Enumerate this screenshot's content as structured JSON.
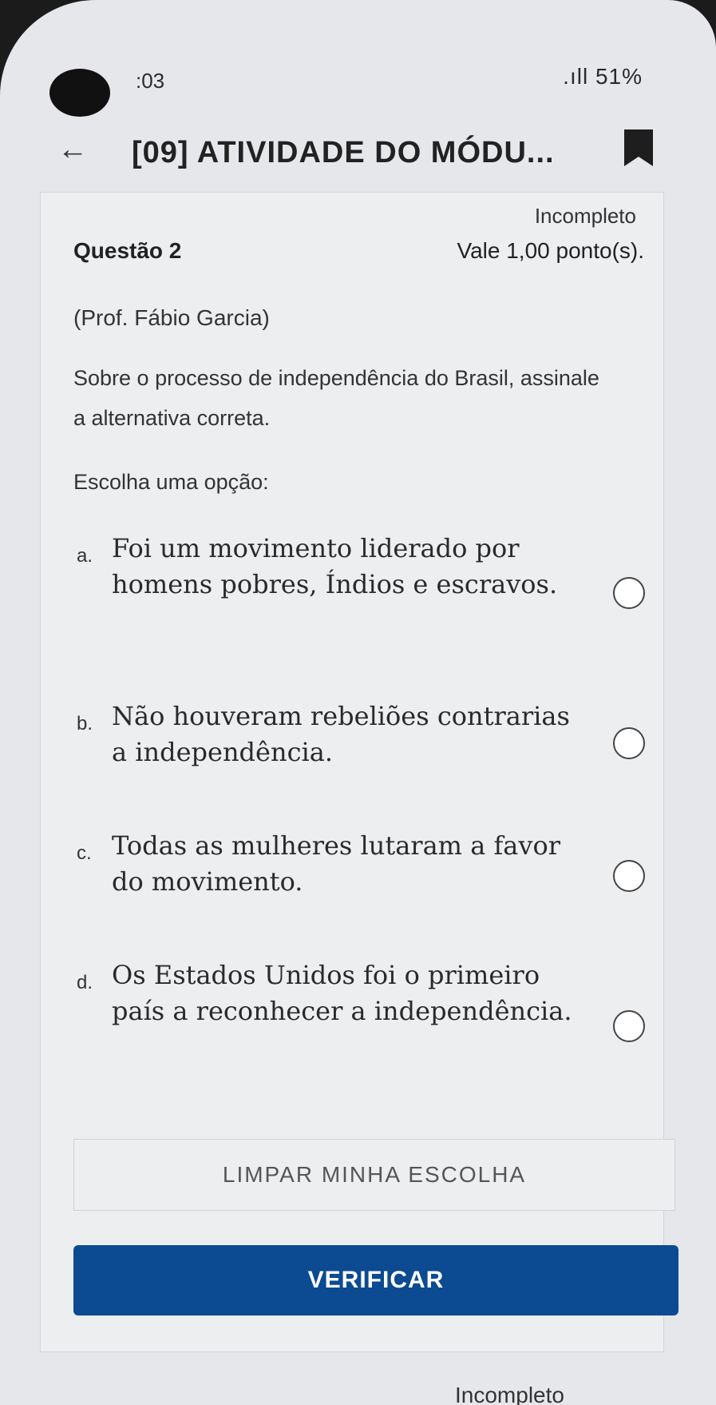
{
  "status_bar": {
    "time": ":03",
    "right": ".ıll 51%"
  },
  "app_bar": {
    "title": "[09] ATIVIDADE DO MÓDU..."
  },
  "question": {
    "state": "Incompleto",
    "label": "Questão 2",
    "points": "Vale 1,00 ponto(s).",
    "author": "(Prof. Fábio Garcia)",
    "prompt": "Sobre o processo de independência do Brasil, assinale a alternativa correta.",
    "choose_label": "Escolha uma opção:",
    "options": [
      {
        "letter": "a.",
        "text": "Foi um movimento liderado por homens pobres, Índios e escravos."
      },
      {
        "letter": "b.",
        "text": "Não houveram rebeliões contrarias a independência."
      },
      {
        "letter": "c.",
        "text": "Todas as mulheres lutaram a favor do movimento."
      },
      {
        "letter": "d.",
        "text": "Os Estados Unidos foi o primeiro país a reconhecer a independência."
      }
    ]
  },
  "buttons": {
    "clear": "LIMPAR MINHA ESCOLHA",
    "verify": "VERIFICAR"
  },
  "next_question": {
    "state": "Incompleto"
  }
}
